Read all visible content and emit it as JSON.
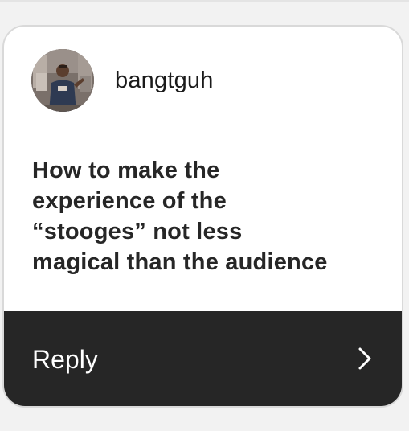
{
  "card": {
    "username": "bangtguh",
    "question": "How to make the\nexperience of the\n“stooges” not less\nmagical than the audience",
    "avatar_icon": "profile-photo",
    "reply_label": "Reply",
    "reply_icon": "chevron-right-icon"
  },
  "colors": {
    "card_background": "#ffffff",
    "reply_bar_background": "#262626",
    "text_primary": "#262626",
    "reply_text": "#ffffff"
  }
}
